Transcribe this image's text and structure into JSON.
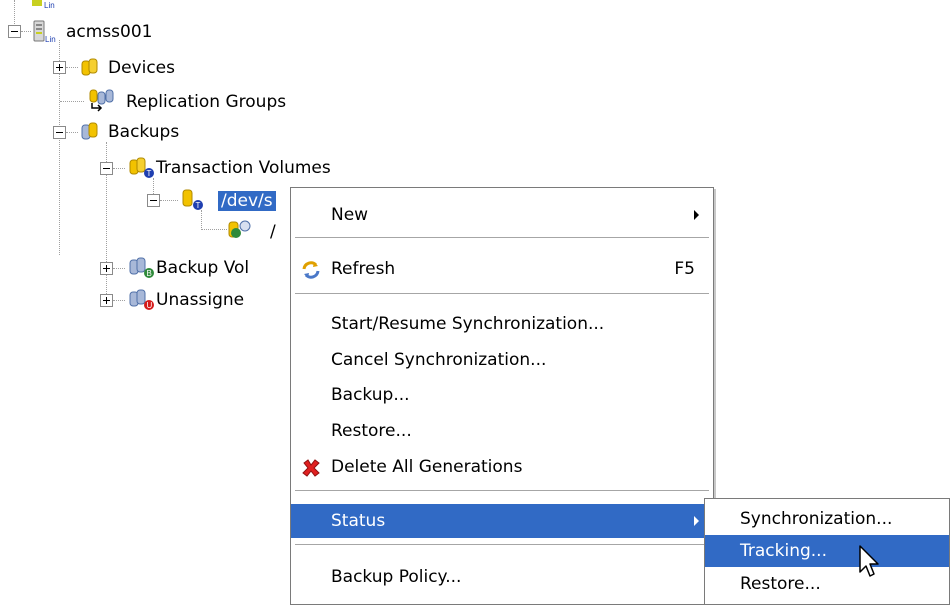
{
  "tree": {
    "root_label": "acmss001",
    "root_badge": "Lin",
    "items": [
      {
        "label": "Devices"
      },
      {
        "label": "Replication Groups"
      },
      {
        "label": "Backups"
      },
      {
        "label": "Transaction Volumes"
      },
      {
        "label": "/dev/s",
        "selected": true
      },
      {
        "label": "/"
      },
      {
        "label": "Backup Vol"
      },
      {
        "label": "Unassigne"
      }
    ]
  },
  "context_menu": {
    "items": [
      {
        "label": "New",
        "has_submenu": true
      },
      {
        "label": "Refresh",
        "shortcut": "F5",
        "icon": "refresh-icon"
      },
      {
        "label": "Start/Resume Synchronization..."
      },
      {
        "label": "Cancel Synchronization..."
      },
      {
        "label": "Backup..."
      },
      {
        "label": "Restore..."
      },
      {
        "label": "Delete All Generations",
        "icon": "delete-x-icon"
      },
      {
        "label": "Status",
        "has_submenu": true,
        "highlighted": true
      },
      {
        "label": "Backup Policy..."
      }
    ]
  },
  "submenu": {
    "items": [
      {
        "label": "Synchronization..."
      },
      {
        "label": "Tracking...",
        "highlighted": true
      },
      {
        "label": "Restore..."
      }
    ]
  },
  "colors": {
    "highlight": "#316ac5",
    "highlight_text": "#ffffff",
    "volume_yellow": "#f2c200",
    "volume_blue": "#4a78c8",
    "badge_blue": "#1f3fb0",
    "badge_green": "#2f8a3a",
    "badge_red": "#d41a1a"
  }
}
